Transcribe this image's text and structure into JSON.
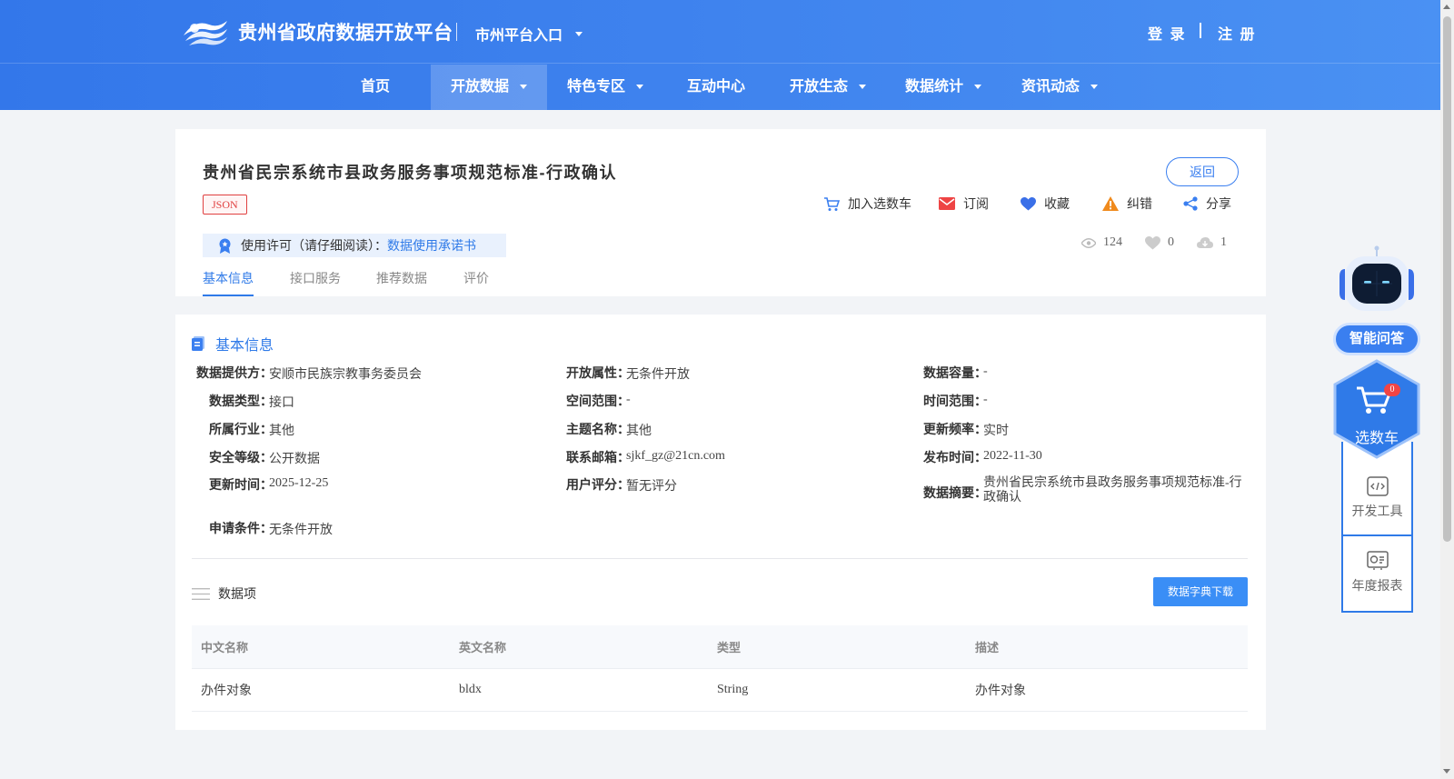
{
  "header": {
    "site_title": "贵州省政府数据开放平台",
    "city_entry": "市州平台入口",
    "login": "登 录",
    "register": "注 册"
  },
  "nav": {
    "items": [
      {
        "label": "首页"
      },
      {
        "label": "开放数据"
      },
      {
        "label": "特色专区"
      },
      {
        "label": "互动中心"
      },
      {
        "label": "开放生态"
      },
      {
        "label": "数据统计"
      },
      {
        "label": "资讯动态"
      }
    ],
    "active_index": 1
  },
  "dataset": {
    "title": "贵州省民宗系统市县政务服务事项规范标准-行政确认",
    "format_tag": "JSON",
    "back_label": "返回",
    "actions": {
      "add_cart": "加入选数车",
      "subscribe": "订阅",
      "favorite": "收藏",
      "report_error": "纠错",
      "share": "分享"
    },
    "license_label": "使用许可（请仔细阅读）：",
    "license_link": "数据使用承诺书",
    "stats": {
      "views": "124",
      "likes": "0",
      "downloads": "1"
    },
    "tabs": [
      "基本信息",
      "接口服务",
      "推荐数据",
      "评价"
    ]
  },
  "basic_info": {
    "section_title": "基本信息",
    "fields": {
      "provider": {
        "label": "数据提供方：",
        "value": "安顺市民族宗教事务委员会"
      },
      "open_attr": {
        "label": "开放属性：",
        "value": "无条件开放"
      },
      "capacity": {
        "label": "数据容量：",
        "value": "-"
      },
      "data_type": {
        "label": "数据类型：",
        "value": "接口"
      },
      "spatial": {
        "label": "空间范围：",
        "value": "-"
      },
      "time_range": {
        "label": "时间范围：",
        "value": "-"
      },
      "industry": {
        "label": "所属行业：",
        "value": "其他"
      },
      "theme": {
        "label": "主题名称：",
        "value": "其他"
      },
      "frequency": {
        "label": "更新频率：",
        "value": "实时"
      },
      "security": {
        "label": "安全等级：",
        "value": "公开数据"
      },
      "email": {
        "label": "联系邮箱：",
        "value": "sjkf_gz@21cn.com"
      },
      "publish_time": {
        "label": "发布时间：",
        "value": "2022-11-30"
      },
      "update_time": {
        "label": "更新时间：",
        "value": "2025-12-25"
      },
      "rating": {
        "label": "用户评分：",
        "value": "暂无评分"
      },
      "summary": {
        "label": "数据摘要：",
        "value": "贵州省民宗系统市县政务服务事项规范标准-行政确认"
      },
      "condition": {
        "label": "申请条件：",
        "value": "无条件开放"
      }
    }
  },
  "data_items": {
    "title": "数据项",
    "dict_download": "数据字典下载",
    "columns": [
      "中文名称",
      "英文名称",
      "类型",
      "描述"
    ],
    "rows": [
      [
        "办件对象",
        "bldx",
        "String",
        "办件对象"
      ]
    ]
  },
  "float_tools": {
    "qa": "智能问答",
    "cart": "选数车",
    "cart_count": "0",
    "dev_tools": "开发工具",
    "annual_report": "年度报表"
  },
  "colors": {
    "header_start": "#3377ea",
    "header_end": "#4a91f3",
    "accent": "#2f7ae8",
    "tag_red": "#e04040"
  }
}
